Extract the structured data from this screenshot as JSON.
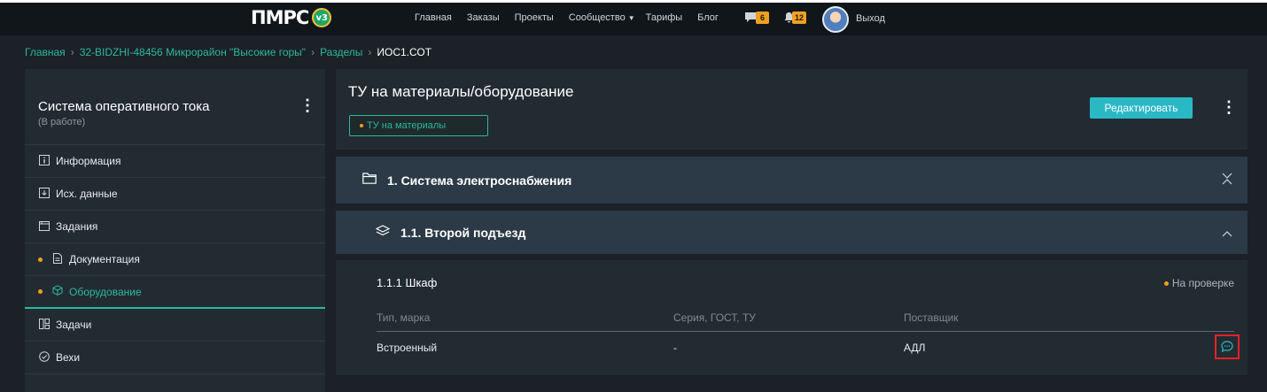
{
  "header": {
    "logo_text": "ПМРС",
    "logo_badge": "v3",
    "nav": [
      "Главная",
      "Заказы",
      "Проекты",
      "Сообщество",
      "Тарифы",
      "Блог"
    ],
    "messages_count": "6",
    "notifications_count": "12",
    "logout_label": "Выход"
  },
  "breadcrumb": {
    "items": [
      "Главная",
      "32-BIDZHI-48456 Микрорайон \"Высокие горы\"",
      "Разделы"
    ],
    "current": "ИОС1.СОТ"
  },
  "sidebar": {
    "title": "Система оперативного тока",
    "subtitle": "(В работе)",
    "items": [
      {
        "label": "Информация",
        "icon": "info-icon"
      },
      {
        "label": "Исх. данные",
        "icon": "download-icon"
      },
      {
        "label": "Задания",
        "icon": "tasks-folder-icon"
      },
      {
        "label": "Документация",
        "icon": "document-icon"
      },
      {
        "label": "Оборудование",
        "icon": "cube-icon"
      },
      {
        "label": "Задачи",
        "icon": "board-icon"
      },
      {
        "label": "Вехи",
        "icon": "check-circle-icon"
      }
    ]
  },
  "main": {
    "title": "ТУ на материалы/оборудование",
    "tag": "ТУ на материалы",
    "edit_label": "Редактировать",
    "section": {
      "title": "1. Система электроснабжения",
      "icon": "folder-icon"
    },
    "subsection": {
      "title": "1.1. Второй подъезд",
      "icon": "layers-icon"
    },
    "item": {
      "title": "1.1.1 Шкаф",
      "status": "На проверке",
      "columns": [
        "Тип, марка",
        "Серия, ГОСТ, ТУ",
        "Поставщик"
      ],
      "row": [
        "Встроенный",
        "-",
        "АДЛ"
      ]
    }
  },
  "colors": {
    "accent": "#2bb8a0",
    "button": "#2bb8c5",
    "status_dot": "#f0a020",
    "highlight": "#e12424"
  }
}
